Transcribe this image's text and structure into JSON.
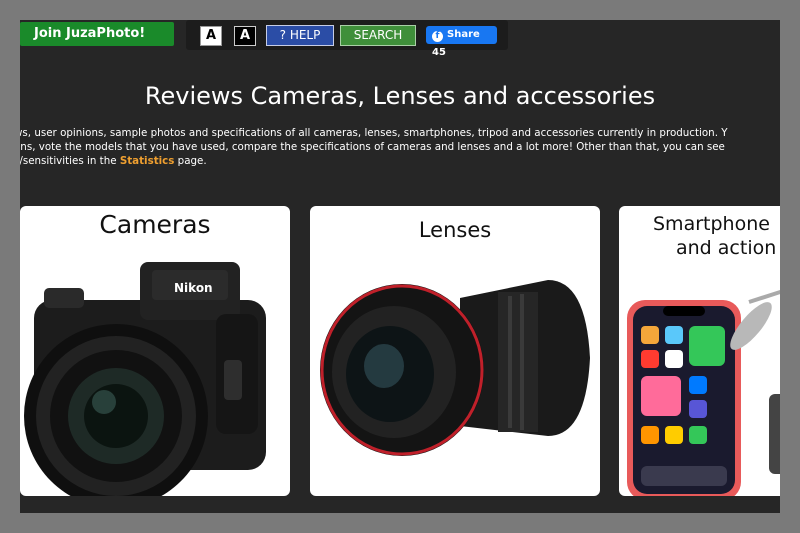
{
  "header": {
    "join_label": "Join JuzaPhoto!",
    "font_small_label": "A",
    "font_large_label": "A",
    "help_label": "? HELP",
    "search_label": "SEARCH",
    "share_label": "Share 45",
    "share_icon": "f"
  },
  "main": {
    "title": "Reviews Cameras, Lenses and accessories",
    "desc_line1": "ws, user opinions, sample photos and specifications of all cameras, lenses, smartphones, tripod and accessories currently in production. Y",
    "desc_line2": "ons, vote the models that you have used, compare the specifications of cameras and lenses and a lot more! Other than that, you can see",
    "desc_line3_pre": "s/sensitivities in the ",
    "desc_link": "Statistics",
    "desc_line3_post": " page."
  },
  "categories": [
    {
      "title": "Cameras",
      "icon": "camera-icon",
      "badge": "Nikon"
    },
    {
      "title": "Lenses",
      "icon": "lens-icon"
    },
    {
      "title_line1": "Smartphone",
      "title_line2": "and action",
      "icon": "smartphone-icon"
    }
  ],
  "colors": {
    "join": "#1a8a2a",
    "help": "#2b4da6",
    "search": "#3f8f3a",
    "facebook": "#1877f2",
    "link": "#f0a030",
    "page_bg": "#262626",
    "frame": "#7a7a7a"
  }
}
